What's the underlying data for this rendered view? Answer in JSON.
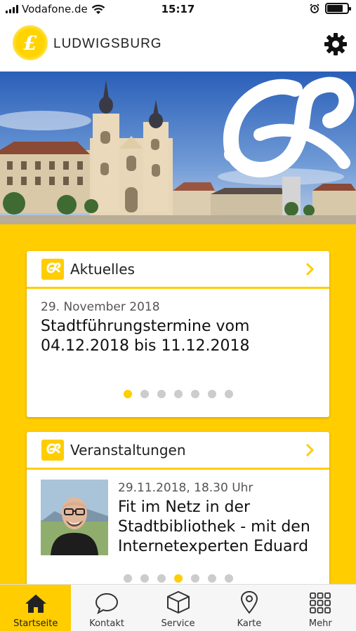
{
  "status_bar": {
    "carrier": "Vodafone.de",
    "time": "15:17",
    "battery_level": 0.8
  },
  "header": {
    "logo_text": "LUDWIGSBURG",
    "logo_glyph": "£",
    "settings_icon": "gear-icon"
  },
  "news": {
    "section_title": "Aktuelles",
    "date": "29. November 2018",
    "headline": "Stadtführungstermine vom 04.12.2018 bis 11.12.2018",
    "page_count": 7,
    "active_page": 1
  },
  "events": {
    "section_title": "Veranstaltungen",
    "date": "29.11.2018, 18.30 Uhr",
    "headline": "Fit im Netz in der Stadtbibliothek - mit den Internetexperten Eduard",
    "page_count": 7,
    "active_page": 4
  },
  "tabs": [
    {
      "label": "Startseite",
      "icon": "home-icon",
      "active": true
    },
    {
      "label": "Kontakt",
      "icon": "chat-bubble-icon",
      "active": false
    },
    {
      "label": "Service",
      "icon": "box-icon",
      "active": false
    },
    {
      "label": "Karte",
      "icon": "map-pin-icon",
      "active": false
    },
    {
      "label": "Mehr",
      "icon": "grid-icon",
      "active": false
    }
  ],
  "colors": {
    "accent": "#ffcd00",
    "dot_inactive": "#cccccc"
  }
}
